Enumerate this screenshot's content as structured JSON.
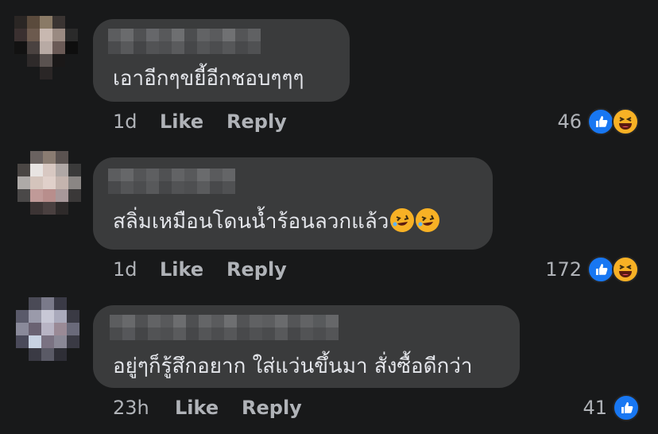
{
  "comments": [
    {
      "text": "เอาอีกๆขยี้อีกชอบๆๆๆ",
      "time": "1d",
      "like_label": "Like",
      "reply_label": "Reply",
      "reaction_count": "46",
      "reactions": [
        "like-icon",
        "haha-icon"
      ]
    },
    {
      "text": "สลิ่มเหมือนโดนน้ำร้อนลวกแล้ว",
      "text_emojis": [
        "rolling-laughing-icon",
        "rolling-laughing-icon"
      ],
      "time": "1d",
      "like_label": "Like",
      "reply_label": "Reply",
      "reaction_count": "172",
      "reactions": [
        "like-icon",
        "haha-icon"
      ]
    },
    {
      "text": "อยู่ๆก็รู้สึกอยาก ใส่แว่นขึ้นมา สั่งซื้อดีกว่า",
      "time": "23h",
      "like_label": "Like",
      "reply_label": "Reply",
      "reaction_count": "41",
      "reactions": [
        "like-icon"
      ]
    }
  ],
  "colors": {
    "background": "#18191a",
    "bubble": "#3a3b3c",
    "text": "#e4e6eb",
    "meta": "#b0b3b8",
    "like_blue": "#1877f2",
    "haha_yellow": "#f7b125"
  }
}
